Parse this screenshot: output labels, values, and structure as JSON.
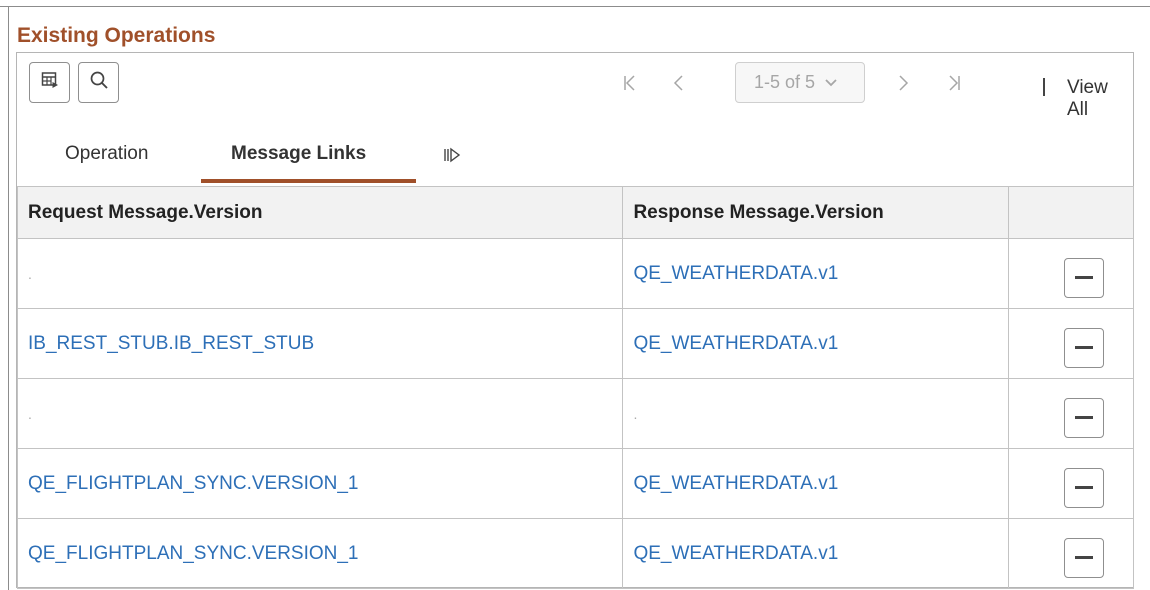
{
  "section": {
    "title": "Existing Operations"
  },
  "toolbar": {
    "grid_icon": "grid-export-icon",
    "search_icon": "search-icon",
    "page_range": "1-5 of 5",
    "view_all": "View All"
  },
  "tabs": [
    {
      "label": "Operation",
      "active": false
    },
    {
      "label": "Message Links",
      "active": true
    }
  ],
  "table": {
    "headers": [
      "Request Message.Version",
      "Response Message.Version",
      ""
    ],
    "rows": [
      {
        "request": ".",
        "response": "QE_WEATHERDATA.v1"
      },
      {
        "request": "IB_REST_STUB.IB_REST_STUB",
        "response": "QE_WEATHERDATA.v1"
      },
      {
        "request": ".",
        "response": "."
      },
      {
        "request": "QE_FLIGHTPLAN_SYNC.VERSION_1",
        "response": "QE_WEATHERDATA.v1"
      },
      {
        "request": "QE_FLIGHTPLAN_SYNC.VERSION_1",
        "response": "QE_WEATHERDATA.v1"
      }
    ]
  },
  "colors": {
    "title": "#a0502a",
    "link": "#2d6fb7",
    "tab_underline": "#a0502a"
  }
}
